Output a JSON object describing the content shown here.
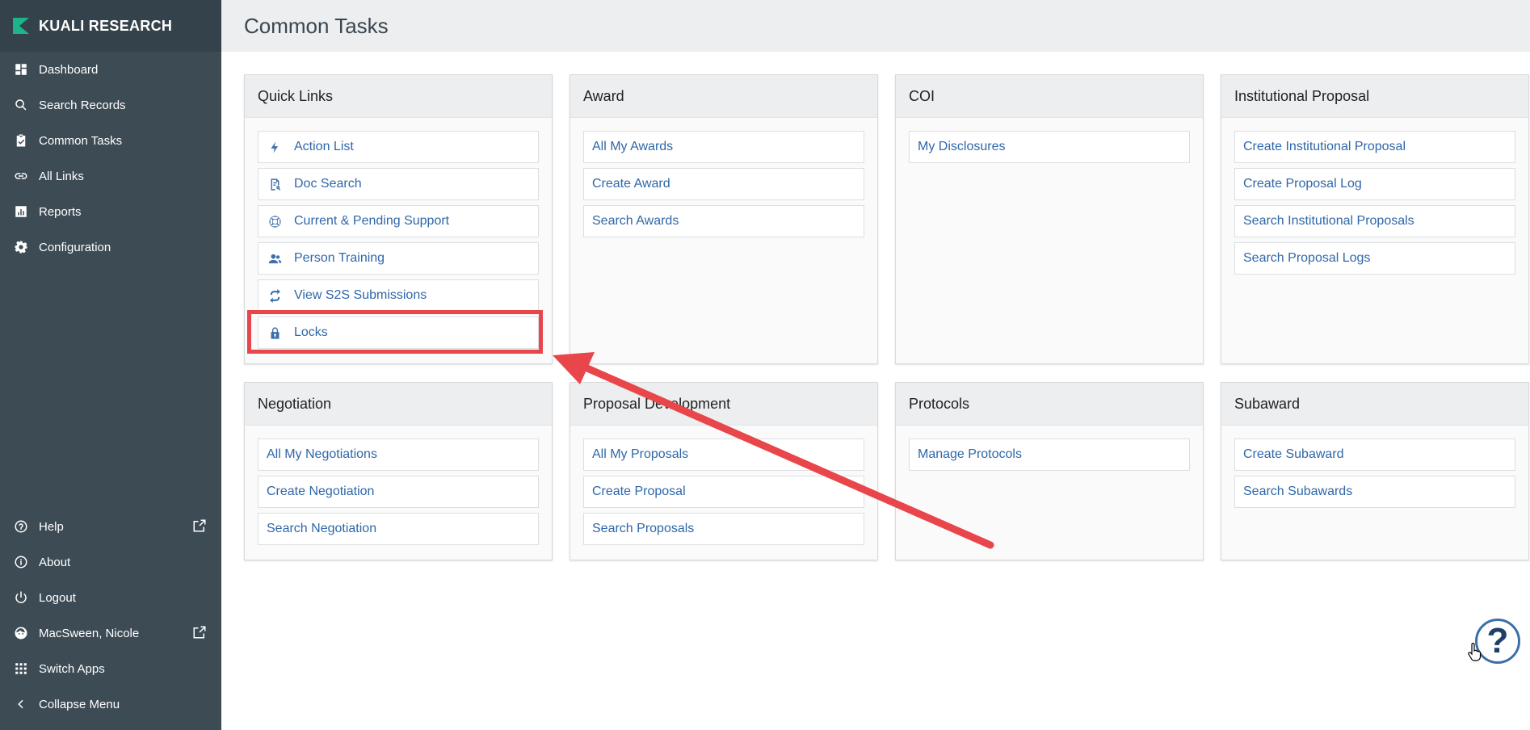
{
  "brand": {
    "name": "KUALI RESEARCH",
    "logo_icon": "kuali-logo-icon",
    "logo_color": "#1cb58a"
  },
  "sidebar": {
    "top_items": [
      {
        "label": "Dashboard",
        "icon": "dashboard-icon"
      },
      {
        "label": "Search Records",
        "icon": "search-icon"
      },
      {
        "label": "Common Tasks",
        "icon": "clipboard-check-icon"
      },
      {
        "label": "All Links",
        "icon": "link-icon"
      },
      {
        "label": "Reports",
        "icon": "bar-chart-icon"
      },
      {
        "label": "Configuration",
        "icon": "gear-icon"
      }
    ],
    "bottom_items": [
      {
        "label": "Help",
        "icon": "help-circle-icon",
        "external": true
      },
      {
        "label": "About",
        "icon": "info-icon"
      },
      {
        "label": "Logout",
        "icon": "power-icon"
      },
      {
        "label": "MacSween, Nicole",
        "icon": "user-face-icon",
        "external": true
      },
      {
        "label": "Switch Apps",
        "icon": "apps-grid-icon"
      },
      {
        "label": "Collapse Menu",
        "icon": "chevron-left-icon"
      }
    ]
  },
  "header": {
    "title": "Common Tasks"
  },
  "cards": {
    "quick_links": {
      "title": "Quick Links",
      "links": [
        {
          "label": "Action List",
          "icon": "lightning-icon"
        },
        {
          "label": "Doc Search",
          "icon": "document-search-icon"
        },
        {
          "label": "Current & Pending Support",
          "icon": "lifebuoy-icon"
        },
        {
          "label": "Person Training",
          "icon": "people-icon"
        },
        {
          "label": "View S2S Submissions",
          "icon": "swap-arrows-icon"
        },
        {
          "label": "Locks",
          "icon": "lock-icon"
        }
      ]
    },
    "award": {
      "title": "Award",
      "links": [
        "All My Awards",
        "Create Award",
        "Search Awards"
      ]
    },
    "coi": {
      "title": "COI",
      "links": [
        "My Disclosures"
      ]
    },
    "institutional_proposal": {
      "title": "Institutional Proposal",
      "links": [
        "Create Institutional Proposal",
        "Create Proposal Log",
        "Search Institutional Proposals",
        "Search Proposal Logs"
      ]
    },
    "negotiation": {
      "title": "Negotiation",
      "links": [
        "All My Negotiations",
        "Create Negotiation",
        "Search Negotiation"
      ]
    },
    "proposal_development": {
      "title": "Proposal Development",
      "links": [
        "All My Proposals",
        "Create Proposal",
        "Search Proposals"
      ]
    },
    "protocols": {
      "title": "Protocols",
      "links": [
        "Manage Protocols"
      ]
    },
    "subaward": {
      "title": "Subaward",
      "links": [
        "Create Subaward",
        "Search Subawards"
      ]
    }
  },
  "annotation": {
    "highlight_color": "#e8464a",
    "target": "Locks"
  },
  "help_bubble": {
    "label": "?"
  }
}
